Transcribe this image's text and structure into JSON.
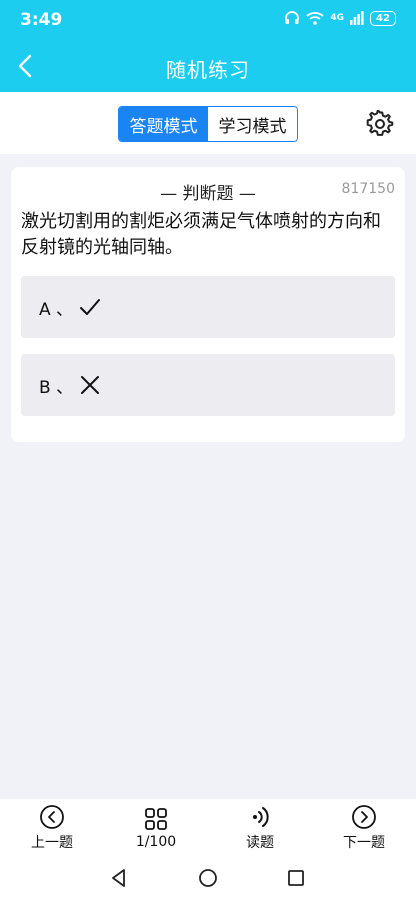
{
  "status": {
    "time": "3:49",
    "battery": "42",
    "net": "4G"
  },
  "nav": {
    "title": "随机练习"
  },
  "modes": {
    "answer": "答题模式",
    "study": "学习模式"
  },
  "question": {
    "type": "— 判断题 —",
    "id": "817150",
    "text": "激光切割用的割炬必须满足气体喷射的方向和反射镜的光轴同轴。",
    "options": [
      {
        "letter": "A 、",
        "icon": "check-icon"
      },
      {
        "letter": "B 、",
        "icon": "cross-icon"
      }
    ]
  },
  "bottom": {
    "prev": "上一题",
    "progress": "1/100",
    "read": "读题",
    "next": "下一题"
  },
  "colors": {
    "header": "#1ccdf0",
    "accent": "#1a84f2",
    "background": "#f1f2f7"
  }
}
